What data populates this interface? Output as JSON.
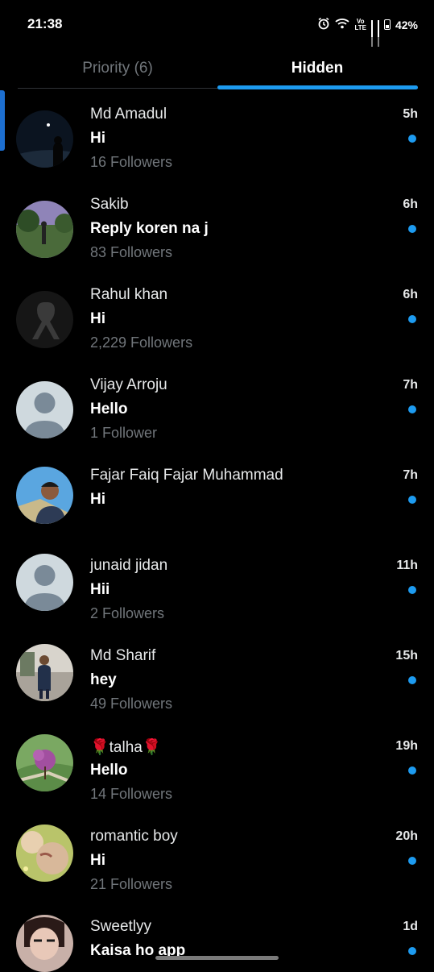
{
  "status_bar": {
    "time": "21:38",
    "net_top": "Vo",
    "net_bottom": "LTE",
    "battery": "42%"
  },
  "tabs": {
    "priority": "Priority (6)",
    "hidden": "Hidden"
  },
  "conversations": [
    {
      "name": "Md Amadul",
      "message": "Hi",
      "followers": "16 Followers",
      "time": "5h",
      "unread": true
    },
    {
      "name": "Sakib",
      "message": "Reply koren na j",
      "followers": "83 Followers",
      "time": "6h",
      "unread": true
    },
    {
      "name": "Rahul khan",
      "message": "Hi",
      "followers": "2,229 Followers",
      "time": "6h",
      "unread": true
    },
    {
      "name": "Vijay Arroju",
      "message": "Hello",
      "followers": "1 Follower",
      "time": "7h",
      "unread": true
    },
    {
      "name": "Fajar Faiq Fajar Muhammad",
      "message": "Hi",
      "followers": "",
      "time": "7h",
      "unread": true
    },
    {
      "name": "junaid jidan",
      "message": "Hii",
      "followers": "2 Followers",
      "time": "11h",
      "unread": true
    },
    {
      "name": "Md Sharif",
      "message": "hey",
      "followers": "49 Followers",
      "time": "15h",
      "unread": true
    },
    {
      "name": "🌹talha🌹",
      "message": "Hello",
      "followers": "14 Followers",
      "time": "19h",
      "unread": true
    },
    {
      "name": "romantic boy",
      "message": "Hi",
      "followers": "21 Followers",
      "time": "20h",
      "unread": true
    },
    {
      "name": "Sweetlyy",
      "message": "Kaisa ho app",
      "followers": "",
      "time": "1d",
      "unread": true
    }
  ],
  "colors": {
    "accent": "#1d9bf0",
    "muted": "#71767b",
    "background": "#000000"
  }
}
